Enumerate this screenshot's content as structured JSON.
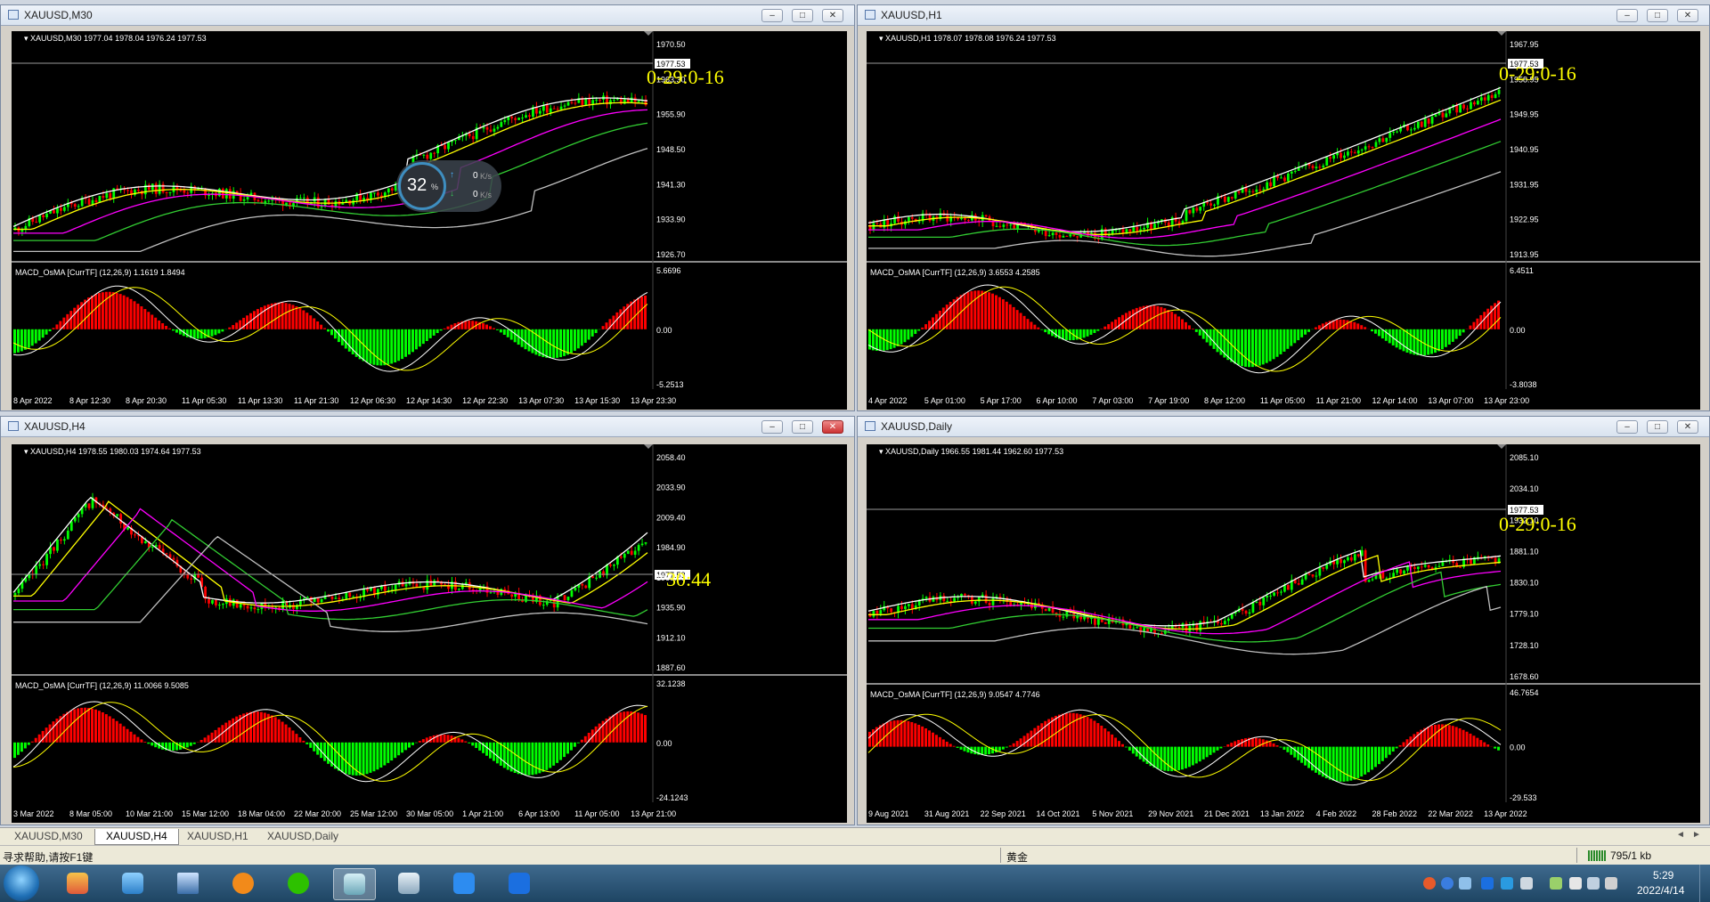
{
  "windows": [
    {
      "id": "m30",
      "title": "XAUUSD,M30",
      "info": "XAUUSD,M30  1977.04 1978.04 1976.24 1977.53",
      "indicator": "MACD_OsMA [CurrTF] (12,26,9) 1.1619 1.8494",
      "price_labels": [
        "1977.53",
        "1970.50",
        "1963.30",
        "1955.90",
        "1948.50",
        "1941.30",
        "1933.90",
        "1926.70"
      ],
      "osc_labels": [
        "5.6696",
        "0.00",
        "-5.2513"
      ],
      "time_labels": [
        "8 Apr 2022",
        "8 Apr 12:30",
        "8 Apr 20:30",
        "11 Apr 05:30",
        "11 Apr 13:30",
        "11 Apr 21:30",
        "12 Apr 06:30",
        "12 Apr 14:30",
        "12 Apr 22:30",
        "13 Apr 07:30",
        "13 Apr 15:30",
        "13 Apr 23:30"
      ],
      "timer": "0-29:0-16"
    },
    {
      "id": "h1",
      "title": "XAUUSD,H1",
      "info": "XAUUSD,H1  1978.07 1978.08 1976.24 1977.53",
      "indicator": "MACD_OsMA [CurrTF] (12,26,9) 3.6553 4.2585",
      "price_labels": [
        "1977.53",
        "1967.95",
        "1958.95",
        "1949.95",
        "1940.95",
        "1931.95",
        "1922.95",
        "1913.95"
      ],
      "osc_labels": [
        "6.4511",
        "0.00",
        "-3.8038"
      ],
      "time_labels": [
        "4 Apr 2022",
        "5 Apr 01:00",
        "5 Apr 17:00",
        "6 Apr 10:00",
        "7 Apr 03:00",
        "7 Apr 19:00",
        "8 Apr 12:00",
        "11 Apr 05:00",
        "11 Apr 21:00",
        "12 Apr 14:00",
        "13 Apr 07:00",
        "13 Apr 23:00"
      ],
      "timer": "0-29:0-16"
    },
    {
      "id": "h4",
      "title": "XAUUSD,H4",
      "info": "XAUUSD,H4  1978.55 1980.03 1974.64 1977.53",
      "indicator": "MACD_OsMA [CurrTF] (12,26,9) 11.0066 9.5085",
      "price_labels": [
        "2058.40",
        "2033.90",
        "2009.40",
        "1984.90",
        "1977.53",
        "1960.40",
        "1935.90",
        "1912.10",
        "1887.60"
      ],
      "osc_labels": [
        "32.1238",
        "0.00",
        "-24.1243"
      ],
      "time_labels": [
        "3 Mar 2022",
        "8 Mar 05:00",
        "10 Mar 21:00",
        "15 Mar 12:00",
        "18 Mar 04:00",
        "22 Mar 20:00",
        "25 Mar 12:00",
        "30 Mar 05:00",
        "1 Apr 21:00",
        "6 Apr 13:00",
        "11 Apr 05:00",
        "13 Apr 21:00"
      ],
      "timer": "30:44"
    },
    {
      "id": "daily",
      "title": "XAUUSD,Daily",
      "info": "XAUUSD,Daily  1966.55 1981.44 1962.60 1977.53",
      "indicator": "MACD_OsMA [CurrTF] (12,26,9) 9.0547 4.7746",
      "price_labels": [
        "2085.10",
        "2034.10",
        "1977.53",
        "1932.10",
        "1881.10",
        "1830.10",
        "1779.10",
        "1728.10",
        "1678.60"
      ],
      "osc_labels": [
        "46.7654",
        "0.00",
        "-29.533"
      ],
      "time_labels": [
        "9 Aug 2021",
        "31 Aug 2021",
        "22 Sep 2021",
        "14 Oct 2021",
        "5 Nov 2021",
        "29 Nov 2021",
        "21 Dec 2021",
        "13 Jan 2022",
        "4 Feb 2022",
        "28 Feb 2022",
        "22 Mar 2022",
        "13 Apr 2022"
      ],
      "timer": "0-29:0-16"
    }
  ],
  "speed_widget": {
    "percent": "32",
    "unit": "%",
    "up": "0",
    "down": "0",
    "rate_unit": "K/s"
  },
  "tabs": [
    "XAUUSD,M30",
    "XAUUSD,H4",
    "XAUUSD,H1",
    "XAUUSD,Daily"
  ],
  "active_tab": "XAUUSD,H4",
  "status": {
    "help": "寻求帮助,请按F1键",
    "symbol_name": "黄金",
    "traffic": "795/1 kb"
  },
  "clock": {
    "time": "5:29",
    "date": "2022/4/14"
  },
  "colors": {
    "bull": "#00ff00",
    "bear": "#ff0000",
    "timer": "#ffff00",
    "ma_white": "#ffffff",
    "ma_yellow": "#ffff00",
    "ma_magenta": "#ff00ff",
    "ma_green": "#32cd32",
    "ma_gray": "#c0c0c0"
  }
}
